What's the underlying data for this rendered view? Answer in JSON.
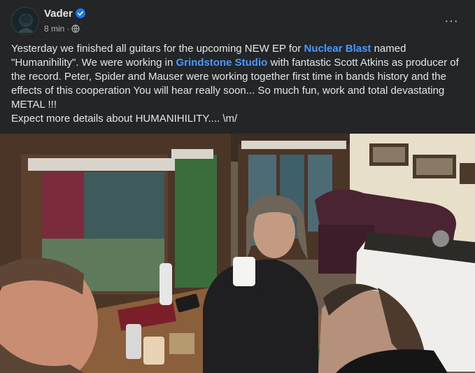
{
  "post": {
    "author": "Vader",
    "time": "8 min",
    "separator": "·",
    "more_label": "···",
    "text": {
      "p1": "Yesterday we finished all guitars for the upcoming NEW EP for ",
      "link1": "Nuclear Blast",
      "p2": " named \"Humanihility\". We were working in ",
      "link2": "Grindstone Studio",
      "p3": " with fantastic Scott Atkins as producer of the record. Peter, Spider and Mauser were working together first time in bands history and  the effects of this cooperation You will hear really soon... So much fun, work and total devastating METAL !!!",
      "line2": "Expect more details about HUMANIHILITY.... \\m/"
    }
  },
  "icons": {
    "verified": "verified-badge-icon",
    "audience": "globe-icon",
    "more": "more-options-icon"
  },
  "colors": {
    "background": "#242526",
    "text": "#e4e6eb",
    "secondary_text": "#b0b3b8",
    "link": "#4599ff",
    "verified": "#1877f2"
  }
}
